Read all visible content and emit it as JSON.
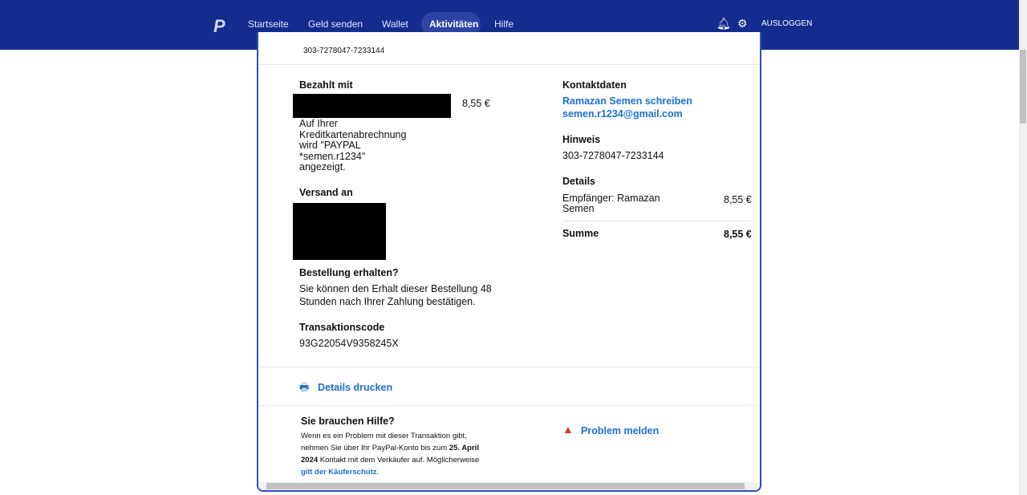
{
  "nav": {
    "items": [
      "Startseite",
      "Geld senden",
      "Wallet",
      "Aktivitäten",
      "Hilfe"
    ],
    "active": "Aktivitäten",
    "logout": "AUSLOGGEN",
    "icons": [
      "bell-icon",
      "gear-icon"
    ]
  },
  "top_ref": "303-7278047-7233144",
  "paid_with": {
    "label": "Bezahlt mit",
    "amount": "8,55 €",
    "note_lines": [
      "Auf Ihrer",
      "Kreditkartenabrechnung",
      "wird \"PAYPAL",
      "*semen.r1234\"",
      "angezeigt."
    ]
  },
  "shipping": {
    "label": "Versand an"
  },
  "order": {
    "label": "Bestellung erhalten?",
    "text_lines": [
      "Sie können den Erhalt dieser Bestellung 48",
      "Stunden nach Ihrer Zahlung bestätigen."
    ]
  },
  "transaction": {
    "label": "Transaktionscode",
    "code": "93G22054V9358245X"
  },
  "contact": {
    "label": "Kontaktdaten",
    "write": "Ramazan Semen schreiben",
    "email": "semen.r1234@gmail.com"
  },
  "note": {
    "label": "Hinweis",
    "value": "303-7278047-7233144"
  },
  "details": {
    "label": "Details",
    "recipient_lines": [
      "Empfänger: Ramazan",
      "Semen"
    ],
    "recipient_amount": "8,55 €",
    "sum_label": "Summe",
    "sum": "8,55 €"
  },
  "print": "Details drucken",
  "help": {
    "title": "Sie brauchen Hilfe?",
    "line1": "Wenn es ein Problem mit dieser Transaktion gibt,",
    "line2a": "nehmen Sie über Ihr PayPal-Konto bis zum ",
    "line2b": "25. April",
    "line3a": "2024",
    "line3b": " Kontakt mit dem Verkäufer auf. Möglicherweise",
    "link": "gilt der Käuferschutz",
    "period": "."
  },
  "report": "Problem melden"
}
